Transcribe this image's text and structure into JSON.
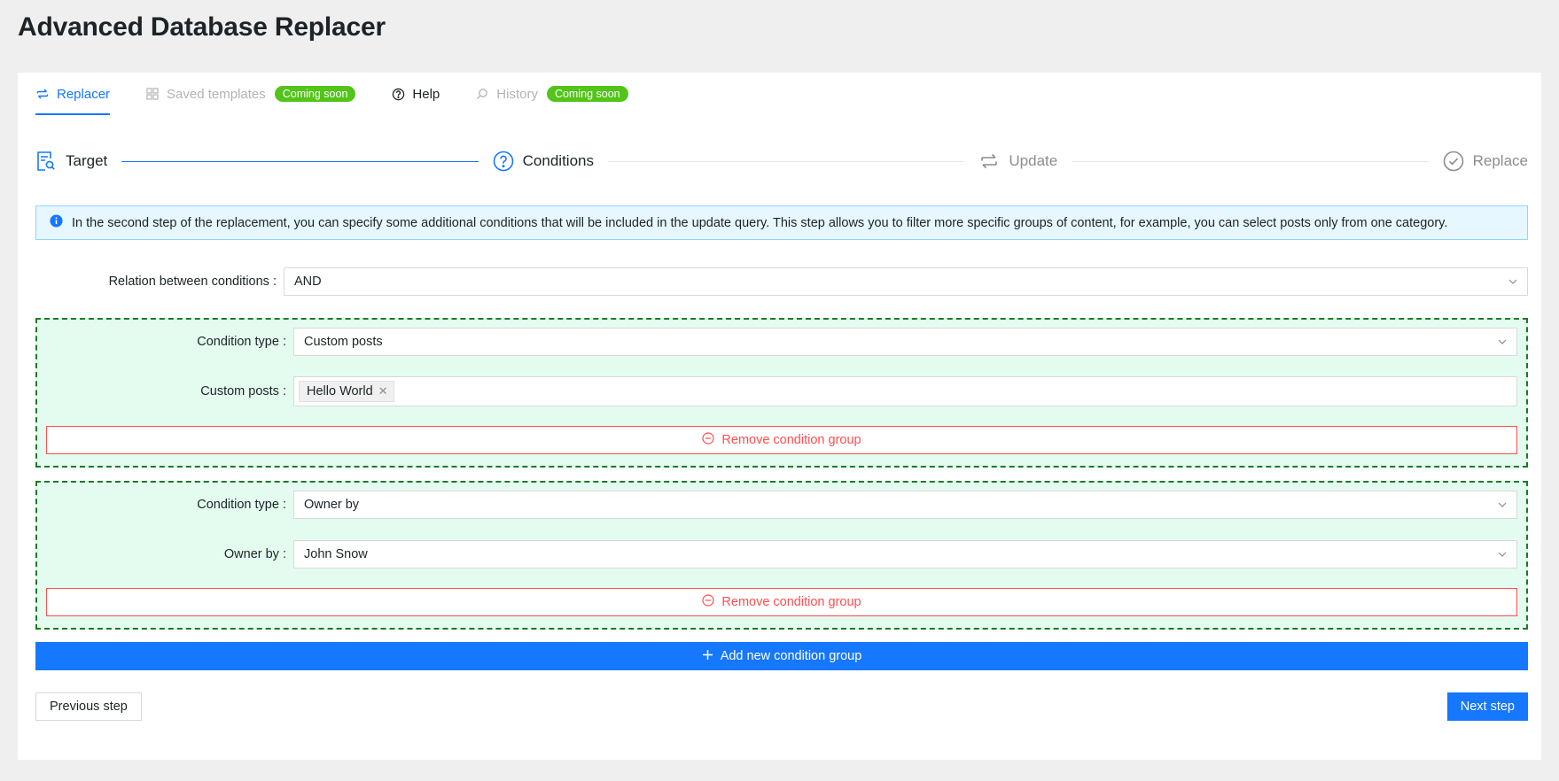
{
  "page": {
    "title": "Advanced Database Replacer"
  },
  "tabs": [
    {
      "label": "Replacer",
      "icon": "swap-icon",
      "state": "active"
    },
    {
      "label": "Saved templates",
      "icon": "grid-icon",
      "state": "disabled",
      "badge": "Coming soon"
    },
    {
      "label": "Help",
      "icon": "question-icon",
      "state": "normal"
    },
    {
      "label": "History",
      "icon": "search-icon",
      "state": "disabled",
      "badge": "Coming soon"
    }
  ],
  "steps": [
    {
      "label": "Target",
      "icon": "file-search-icon",
      "status": "done"
    },
    {
      "label": "Conditions",
      "icon": "question-circle-icon",
      "status": "active"
    },
    {
      "label": "Update",
      "icon": "swap-icon",
      "status": "wait"
    },
    {
      "label": "Replace",
      "icon": "check-circle-icon",
      "status": "wait"
    }
  ],
  "info": {
    "text": "In the second step of the replacement, you can specify some additional conditions that will be included in the update query. This step allows you to filter more specific groups of content, for example, you can select posts only from one category."
  },
  "relation": {
    "label": "Relation between conditions",
    "value": "AND"
  },
  "groups": [
    {
      "type_label": "Condition type",
      "type_value": "Custom posts",
      "field_label": "Custom posts",
      "tags": [
        "Hello World"
      ],
      "remove_label": "Remove condition group"
    },
    {
      "type_label": "Condition type",
      "type_value": "Owner by",
      "field_label": "Owner by",
      "field_value": "John Snow",
      "remove_label": "Remove condition group"
    }
  ],
  "actions": {
    "add_group_label": "Add new condition group",
    "prev_label": "Previous step",
    "next_label": "Next step"
  },
  "colors": {
    "primary": "#1677ff",
    "success": "#52c41a",
    "danger": "#ff4d4f",
    "group_bg": "#e3fcef",
    "group_border": "#1a7a26"
  }
}
